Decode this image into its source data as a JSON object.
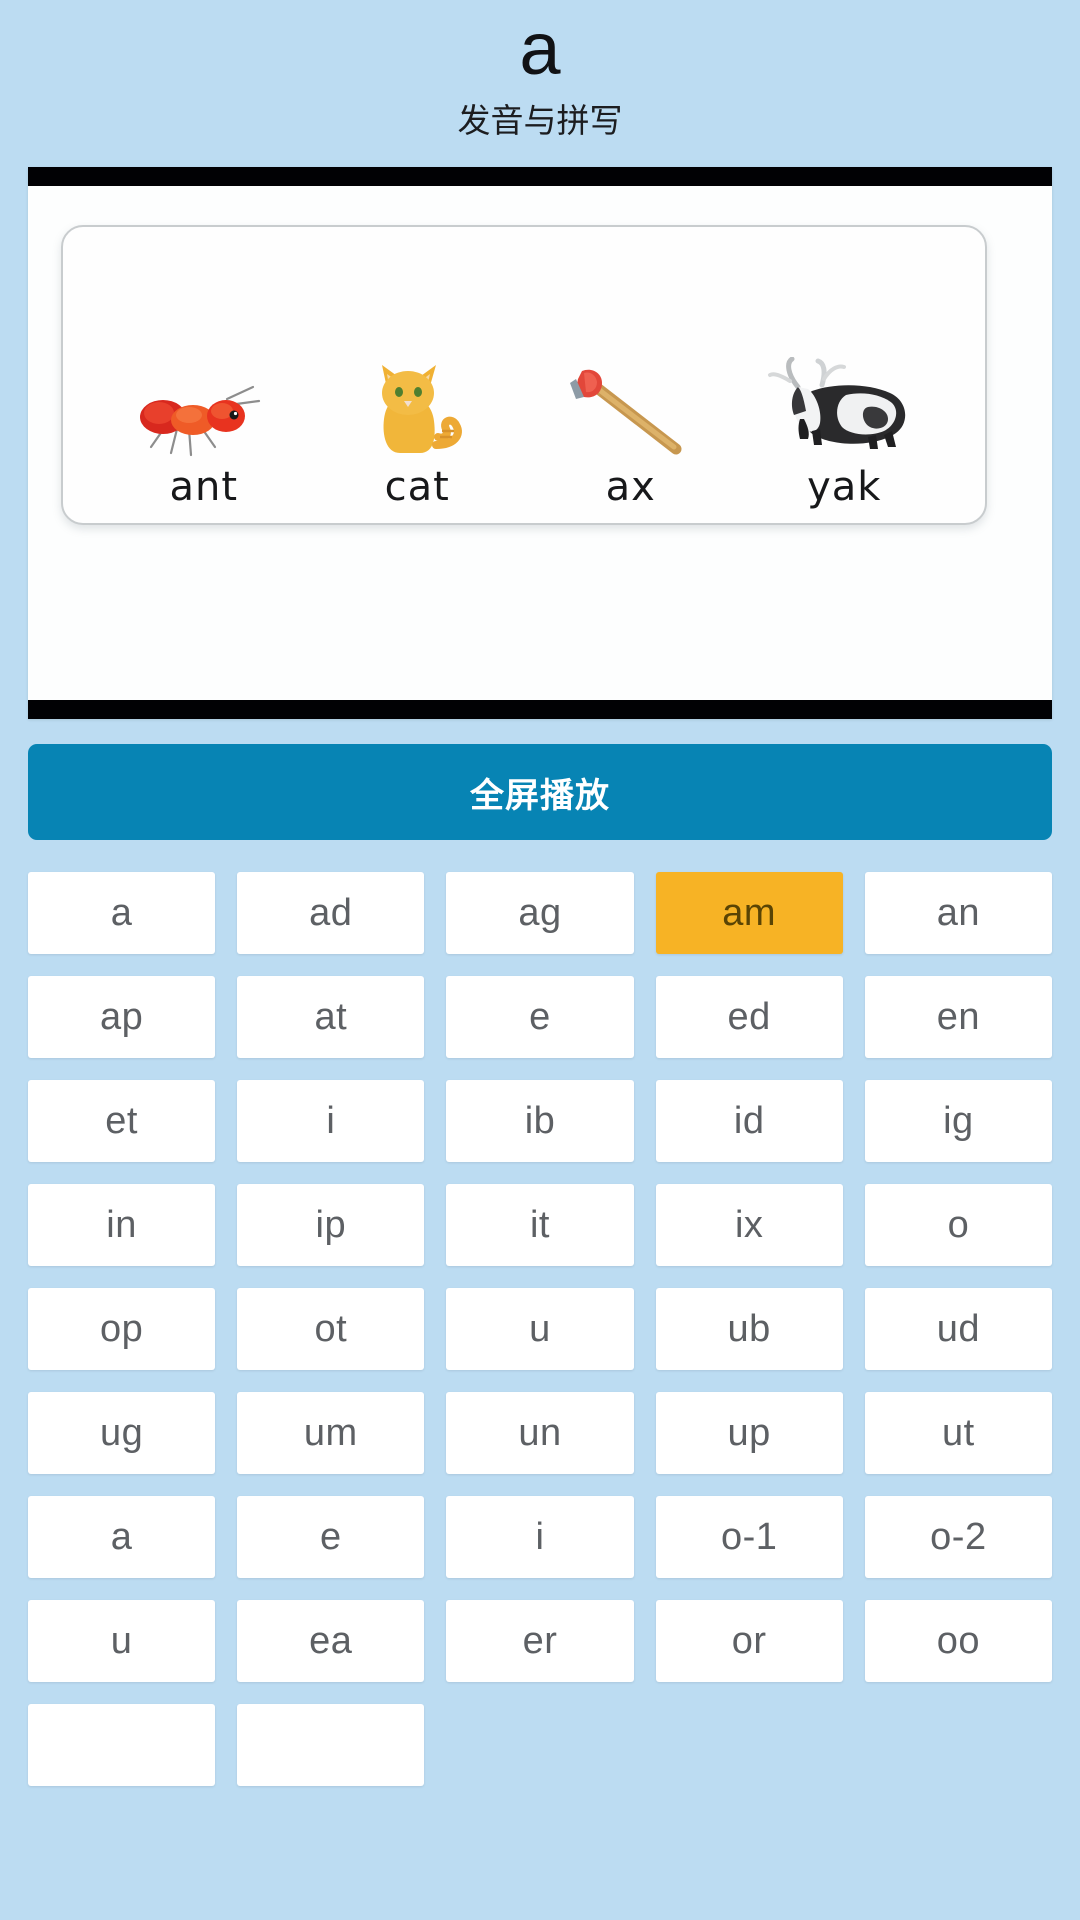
{
  "header": {
    "letter": "a",
    "subtitle": "发音与拼写"
  },
  "media": {
    "words": [
      {
        "label": "ant",
        "art": "ant-illustration"
      },
      {
        "label": "cat",
        "art": "cat-illustration"
      },
      {
        "label": "ax",
        "art": "ax-illustration"
      },
      {
        "label": "yak",
        "art": "yak-illustration"
      }
    ]
  },
  "play_button": {
    "label": "全屏播放"
  },
  "colors": {
    "page_background": "#bcdcf2",
    "play_button": "#0784b4",
    "selected_tile": "#f7b325",
    "selected_tile_text": "#5a4404",
    "tile_background": "#ffffff",
    "tile_text": "#5d6064",
    "letterbox": "#010104"
  },
  "tiles": [
    {
      "label": "a",
      "selected": false
    },
    {
      "label": "ad",
      "selected": false
    },
    {
      "label": "ag",
      "selected": false
    },
    {
      "label": "am",
      "selected": true
    },
    {
      "label": "an",
      "selected": false
    },
    {
      "label": "ap",
      "selected": false
    },
    {
      "label": "at",
      "selected": false
    },
    {
      "label": "e",
      "selected": false
    },
    {
      "label": "ed",
      "selected": false
    },
    {
      "label": "en",
      "selected": false
    },
    {
      "label": "et",
      "selected": false
    },
    {
      "label": "i",
      "selected": false
    },
    {
      "label": "ib",
      "selected": false
    },
    {
      "label": "id",
      "selected": false
    },
    {
      "label": "ig",
      "selected": false
    },
    {
      "label": "in",
      "selected": false
    },
    {
      "label": "ip",
      "selected": false
    },
    {
      "label": "it",
      "selected": false
    },
    {
      "label": "ix",
      "selected": false
    },
    {
      "label": "o",
      "selected": false
    },
    {
      "label": "op",
      "selected": false
    },
    {
      "label": "ot",
      "selected": false
    },
    {
      "label": "u",
      "selected": false
    },
    {
      "label": "ub",
      "selected": false
    },
    {
      "label": "ud",
      "selected": false
    },
    {
      "label": "ug",
      "selected": false
    },
    {
      "label": "um",
      "selected": false
    },
    {
      "label": "un",
      "selected": false
    },
    {
      "label": "up",
      "selected": false
    },
    {
      "label": "ut",
      "selected": false
    },
    {
      "label": "a",
      "selected": false
    },
    {
      "label": "e",
      "selected": false
    },
    {
      "label": "i",
      "selected": false
    },
    {
      "label": "o-1",
      "selected": false
    },
    {
      "label": "o-2",
      "selected": false
    },
    {
      "label": "u",
      "selected": false
    },
    {
      "label": "ea",
      "selected": false
    },
    {
      "label": "er",
      "selected": false
    },
    {
      "label": "or",
      "selected": false
    },
    {
      "label": "oo",
      "selected": false
    },
    {
      "label": "",
      "selected": false
    },
    {
      "label": "",
      "selected": false
    }
  ]
}
